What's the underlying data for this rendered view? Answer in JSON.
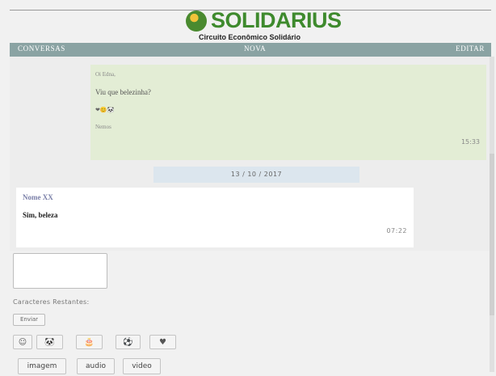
{
  "brand": {
    "name": "SOLIDARIUS",
    "tagline": "Circuito Econômico Solidário"
  },
  "nav": {
    "left": "CONVERSAS",
    "center": "NOVA",
    "right": "EDITAR"
  },
  "colors": {
    "nav_bg": "#8aa3a3",
    "outgoing_bg": "#e3edd5",
    "incoming_bg": "#ffffff",
    "date_bg": "#dce6ee",
    "brand_green": "#3e8a2d"
  },
  "messages": [
    {
      "lines": [
        "Oi Edna,",
        "Viu que belezinha?",
        "❤😊🐼",
        "Nemos"
      ],
      "time": "15:33"
    },
    {
      "author": "Nome XX",
      "text": "Sim, beleza",
      "time": "07:22"
    }
  ],
  "date_separator": "13 / 10 / 2017",
  "composer": {
    "value": "",
    "remaining_label": "Caracteres Restantes:",
    "send_label": "Enviar"
  },
  "emoji_buttons": [
    {
      "icon": "smiley-icon",
      "glyph": "☺"
    },
    {
      "icon": "panda-icon",
      "glyph": "🐼"
    },
    {
      "icon": "cake-icon",
      "glyph": "🎂"
    },
    {
      "icon": "soccer-ball-icon",
      "glyph": "⚽"
    },
    {
      "icon": "heart-icon",
      "glyph": "♥"
    }
  ],
  "media_buttons": {
    "image": "imagem",
    "audio": "audio",
    "video": "video"
  }
}
